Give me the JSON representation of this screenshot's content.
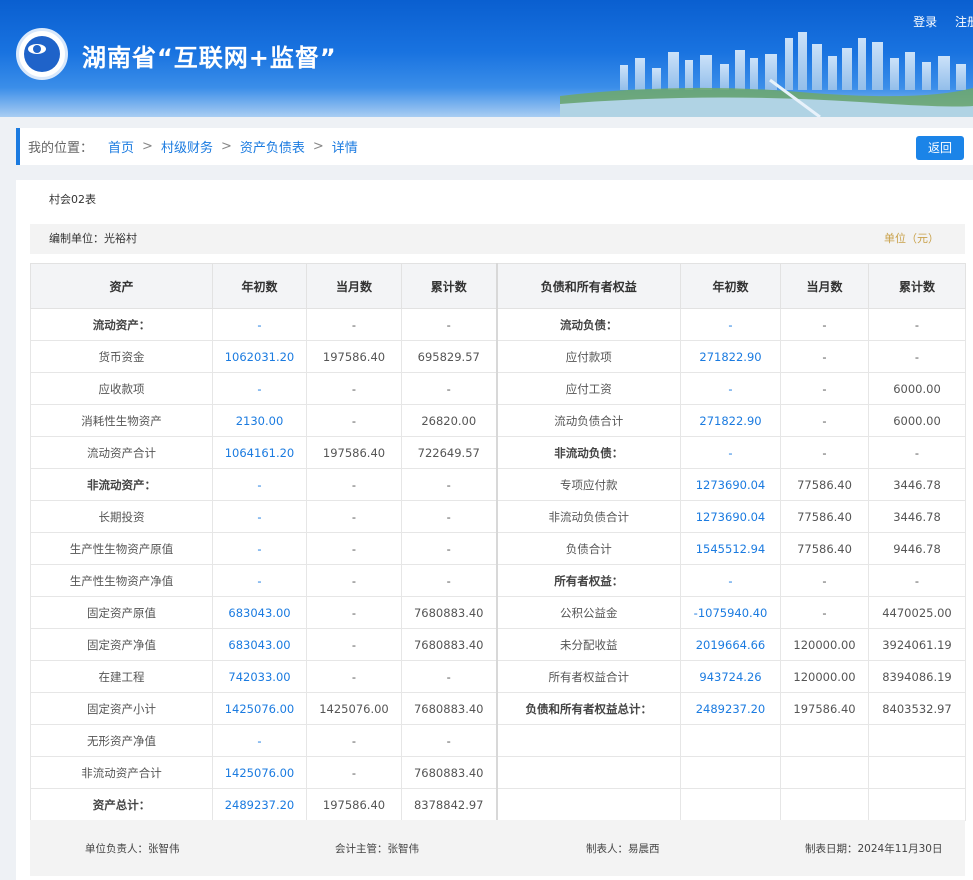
{
  "header": {
    "title": "湖南省“互联网+监督”",
    "login": "登录",
    "register": "注册"
  },
  "breadcrumb": {
    "label": "我的位置：",
    "items": [
      "首页",
      "村级财务",
      "资产负债表",
      "详情"
    ],
    "separator": ">",
    "back": "返回"
  },
  "report": {
    "form_no": "村会02表",
    "org_label": "编制单位：光裕村",
    "unit_label": "单位（元）",
    "columns": [
      "资产",
      "年初数",
      "当月数",
      "累计数",
      "负债和所有者权益",
      "年初数",
      "当月数",
      "累计数"
    ],
    "rows": [
      [
        {
          "t": "流动资产：",
          "b": true
        },
        {
          "t": "-",
          "c": "blue"
        },
        {
          "t": "-"
        },
        {
          "t": "-"
        },
        {
          "t": "流动负债：",
          "b": true
        },
        {
          "t": "-",
          "c": "blue"
        },
        {
          "t": "-"
        },
        {
          "t": "-"
        }
      ],
      [
        {
          "t": "货币资金"
        },
        {
          "t": "1062031.20",
          "c": "blue"
        },
        {
          "t": "197586.40"
        },
        {
          "t": "695829.57"
        },
        {
          "t": "应付款项"
        },
        {
          "t": "271822.90",
          "c": "blue"
        },
        {
          "t": "-"
        },
        {
          "t": "-"
        }
      ],
      [
        {
          "t": "应收款项"
        },
        {
          "t": "-",
          "c": "blue"
        },
        {
          "t": "-"
        },
        {
          "t": "-"
        },
        {
          "t": "应付工资"
        },
        {
          "t": "-",
          "c": "blue"
        },
        {
          "t": "-"
        },
        {
          "t": "6000.00"
        }
      ],
      [
        {
          "t": "消耗性生物资产"
        },
        {
          "t": "2130.00",
          "c": "blue"
        },
        {
          "t": "-"
        },
        {
          "t": "26820.00"
        },
        {
          "t": "流动负债合计"
        },
        {
          "t": "271822.90",
          "c": "blue"
        },
        {
          "t": "-"
        },
        {
          "t": "6000.00"
        }
      ],
      [
        {
          "t": "流动资产合计"
        },
        {
          "t": "1064161.20",
          "c": "blue"
        },
        {
          "t": "197586.40"
        },
        {
          "t": "722649.57"
        },
        {
          "t": "非流动负债：",
          "b": true
        },
        {
          "t": "-",
          "c": "blue"
        },
        {
          "t": "-"
        },
        {
          "t": "-"
        }
      ],
      [
        {
          "t": "非流动资产：",
          "b": true
        },
        {
          "t": "-",
          "c": "blue"
        },
        {
          "t": "-"
        },
        {
          "t": "-"
        },
        {
          "t": "专项应付款"
        },
        {
          "t": "1273690.04",
          "c": "blue"
        },
        {
          "t": "77586.40"
        },
        {
          "t": "3446.78"
        }
      ],
      [
        {
          "t": "长期投资"
        },
        {
          "t": "-",
          "c": "blue"
        },
        {
          "t": "-"
        },
        {
          "t": "-"
        },
        {
          "t": "非流动负债合计"
        },
        {
          "t": "1273690.04",
          "c": "blue"
        },
        {
          "t": "77586.40"
        },
        {
          "t": "3446.78"
        }
      ],
      [
        {
          "t": "生产性生物资产原值"
        },
        {
          "t": "-",
          "c": "blue"
        },
        {
          "t": "-"
        },
        {
          "t": "-"
        },
        {
          "t": "负债合计"
        },
        {
          "t": "1545512.94",
          "c": "blue"
        },
        {
          "t": "77586.40"
        },
        {
          "t": "9446.78"
        }
      ],
      [
        {
          "t": "生产性生物资产净值"
        },
        {
          "t": "-",
          "c": "blue"
        },
        {
          "t": "-"
        },
        {
          "t": "-"
        },
        {
          "t": "所有者权益：",
          "b": true
        },
        {
          "t": "-",
          "c": "blue"
        },
        {
          "t": "-"
        },
        {
          "t": "-"
        }
      ],
      [
        {
          "t": "固定资产原值"
        },
        {
          "t": "683043.00",
          "c": "blue"
        },
        {
          "t": "-"
        },
        {
          "t": "7680883.40"
        },
        {
          "t": "公积公益金"
        },
        {
          "t": "-1075940.40",
          "c": "blue"
        },
        {
          "t": "-"
        },
        {
          "t": "4470025.00"
        }
      ],
      [
        {
          "t": "固定资产净值"
        },
        {
          "t": "683043.00",
          "c": "blue"
        },
        {
          "t": "-"
        },
        {
          "t": "7680883.40"
        },
        {
          "t": "未分配收益"
        },
        {
          "t": "2019664.66",
          "c": "blue"
        },
        {
          "t": "120000.00"
        },
        {
          "t": "3924061.19"
        }
      ],
      [
        {
          "t": "在建工程"
        },
        {
          "t": "742033.00",
          "c": "blue"
        },
        {
          "t": "-"
        },
        {
          "t": "-"
        },
        {
          "t": "所有者权益合计"
        },
        {
          "t": "943724.26",
          "c": "blue"
        },
        {
          "t": "120000.00"
        },
        {
          "t": "8394086.19"
        }
      ],
      [
        {
          "t": "固定资产小计"
        },
        {
          "t": "1425076.00",
          "c": "blue"
        },
        {
          "t": "1425076.00"
        },
        {
          "t": "7680883.40"
        },
        {
          "t": "负债和所有者权益总计：",
          "b": true
        },
        {
          "t": "2489237.20",
          "c": "blue"
        },
        {
          "t": "197586.40"
        },
        {
          "t": "8403532.97"
        }
      ],
      [
        {
          "t": "无形资产净值"
        },
        {
          "t": "-",
          "c": "blue"
        },
        {
          "t": "-"
        },
        {
          "t": "-"
        },
        {
          "t": ""
        },
        {
          "t": ""
        },
        {
          "t": ""
        },
        {
          "t": ""
        }
      ],
      [
        {
          "t": "非流动资产合计"
        },
        {
          "t": "1425076.00",
          "c": "blue"
        },
        {
          "t": "-"
        },
        {
          "t": "7680883.40"
        },
        {
          "t": ""
        },
        {
          "t": ""
        },
        {
          "t": ""
        },
        {
          "t": ""
        }
      ],
      [
        {
          "t": "资产总计：",
          "b": true
        },
        {
          "t": "2489237.20",
          "c": "blue"
        },
        {
          "t": "197586.40"
        },
        {
          "t": "8378842.97"
        },
        {
          "t": ""
        },
        {
          "t": ""
        },
        {
          "t": ""
        },
        {
          "t": ""
        }
      ]
    ],
    "footer": {
      "head": "单位负责人：张智伟",
      "accountant": "会计主管：张智伟",
      "preparer": "制表人：易晨西",
      "date": "制表日期：2024年11月30日"
    }
  },
  "colors": {
    "header_blue": "#0a5fd0",
    "link_blue": "#1b7be0",
    "unit_gold": "#c9a14a"
  },
  "icons": {
    "logo": "supervision-eye-emblem-icon",
    "banner": "city-skyline-illustration"
  }
}
